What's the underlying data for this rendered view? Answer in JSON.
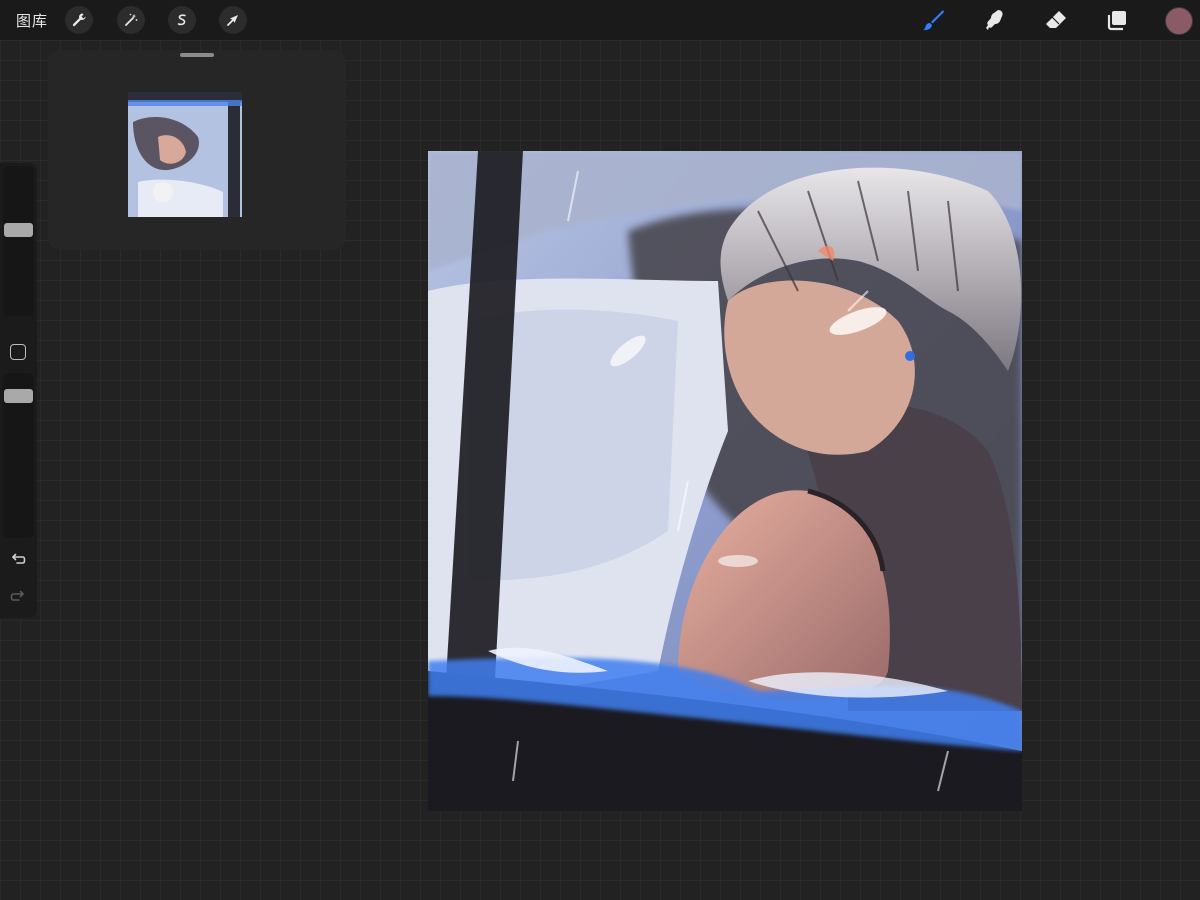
{
  "topbar": {
    "gallery_label": "图库",
    "left_tools": [
      {
        "name": "actions",
        "icon": "wrench-icon"
      },
      {
        "name": "adjustments",
        "icon": "magic-wand-icon"
      },
      {
        "name": "selection",
        "icon": "selection-s-icon"
      },
      {
        "name": "transform",
        "icon": "arrow-cursor-icon"
      }
    ],
    "right_tools": [
      {
        "name": "brush",
        "icon": "brush-icon",
        "active": true
      },
      {
        "name": "smudge",
        "icon": "smudge-finger-icon"
      },
      {
        "name": "eraser",
        "icon": "eraser-icon"
      },
      {
        "name": "layers",
        "icon": "layers-icon"
      }
    ],
    "current_color": "#8a5a66",
    "accent_color": "#2f7fff"
  },
  "sidebar": {
    "brush_size_level": 0.2,
    "brush_opacity_level": 0.2
  },
  "canvas": {
    "artwork": "painting-of-boy-in-rain"
  }
}
